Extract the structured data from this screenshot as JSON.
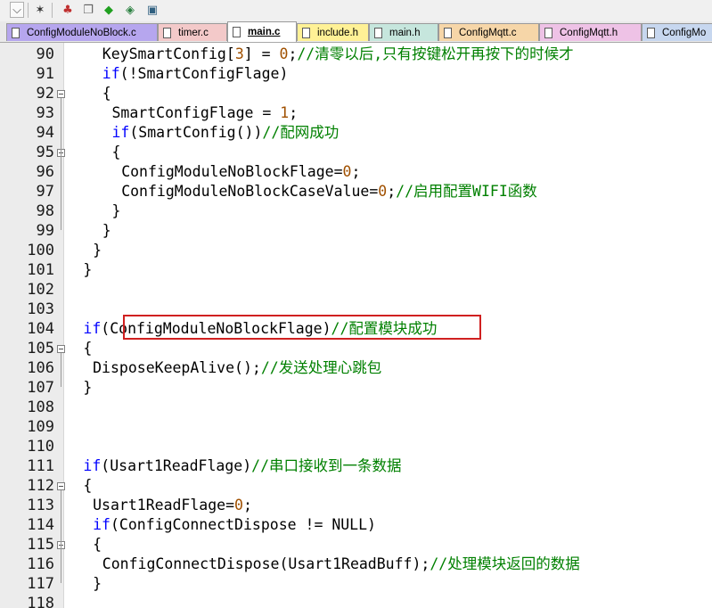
{
  "toolbar": {
    "buttons": [
      {
        "name": "dropdown-arrow-icon",
        "glyph": "⌵"
      },
      {
        "name": "wand-icon",
        "glyph": "✶"
      },
      {
        "name": "tree-icon",
        "glyph": "♣"
      },
      {
        "name": "window-stack-icon",
        "glyph": "❐"
      },
      {
        "name": "green-diamond-icon",
        "glyph": "◆"
      },
      {
        "name": "arrow-diamond-icon",
        "glyph": "◈"
      },
      {
        "name": "image-icon",
        "glyph": "▣"
      }
    ]
  },
  "tabs": [
    {
      "label": "ConfigModuleNoBlock.c",
      "color": "#b6a6ee",
      "active": false
    },
    {
      "label": "timer.c",
      "color": "#f3c9c9",
      "active": false
    },
    {
      "label": "main.c",
      "color": "#ffffff",
      "active": true
    },
    {
      "label": "include.h",
      "color": "#fff196",
      "active": false
    },
    {
      "label": "main.h",
      "color": "#c6e6dd",
      "active": false
    },
    {
      "label": "ConfigMqtt.c",
      "color": "#f6d6a8",
      "active": false
    },
    {
      "label": "ConfigMqtt.h",
      "color": "#eec2e6",
      "active": false
    },
    {
      "label": "ConfigMo",
      "color": "#c7d7ef",
      "active": false
    }
  ],
  "editor": {
    "lines": [
      {
        "num": "90",
        "indent": 4,
        "fold": "",
        "tokens": [
          [
            "p",
            "KeySmartConfig["
          ],
          [
            "n",
            "3"
          ],
          [
            "p",
            "] = "
          ],
          [
            "n",
            "0"
          ],
          [
            "p",
            ";"
          ],
          [
            "c",
            "//清零以后,只有按键松开再按下的时候才"
          ]
        ]
      },
      {
        "num": "91",
        "indent": 4,
        "fold": "",
        "tokens": [
          [
            "k",
            "if"
          ],
          [
            "p",
            "(!SmartConfigFlage)"
          ]
        ]
      },
      {
        "num": "92",
        "indent": 4,
        "fold": "box",
        "tokens": [
          [
            "p",
            "{"
          ]
        ]
      },
      {
        "num": "93",
        "indent": 5,
        "fold": "",
        "tokens": [
          [
            "p",
            "SmartConfigFlage = "
          ],
          [
            "n",
            "1"
          ],
          [
            "p",
            ";"
          ]
        ]
      },
      {
        "num": "94",
        "indent": 5,
        "fold": "",
        "tokens": [
          [
            "k",
            "if"
          ],
          [
            "p",
            "(SmartConfig())"
          ],
          [
            "c",
            "//配网成功"
          ]
        ]
      },
      {
        "num": "95",
        "indent": 5,
        "fold": "box",
        "tokens": [
          [
            "p",
            "{"
          ]
        ]
      },
      {
        "num": "96",
        "indent": 6,
        "fold": "",
        "tokens": [
          [
            "p",
            "ConfigModuleNoBlockFlage="
          ],
          [
            "n",
            "0"
          ],
          [
            "p",
            ";"
          ]
        ]
      },
      {
        "num": "97",
        "indent": 6,
        "fold": "",
        "tokens": [
          [
            "p",
            "ConfigModuleNoBlockCaseValue="
          ],
          [
            "n",
            "0"
          ],
          [
            "p",
            ";"
          ],
          [
            "c",
            "//启用配置WIFI函数"
          ]
        ]
      },
      {
        "num": "98",
        "indent": 5,
        "fold": "",
        "tokens": [
          [
            "p",
            "}"
          ]
        ]
      },
      {
        "num": "99",
        "indent": 4,
        "fold": "",
        "tokens": [
          [
            "p",
            "}"
          ]
        ]
      },
      {
        "num": "100",
        "indent": 3,
        "fold": "",
        "tokens": [
          [
            "p",
            "}"
          ]
        ]
      },
      {
        "num": "101",
        "indent": 2,
        "fold": "",
        "tokens": [
          [
            "p",
            "}"
          ]
        ]
      },
      {
        "num": "102",
        "indent": 0,
        "fold": "",
        "tokens": []
      },
      {
        "num": "103",
        "indent": 0,
        "fold": "",
        "tokens": []
      },
      {
        "num": "104",
        "indent": 2,
        "fold": "",
        "tokens": [
          [
            "k",
            "if"
          ],
          [
            "p",
            "(ConfigModuleNoBlockFlage)"
          ],
          [
            "c",
            "//配置模块成功"
          ]
        ]
      },
      {
        "num": "105",
        "indent": 2,
        "fold": "box",
        "tokens": [
          [
            "p",
            "{"
          ]
        ]
      },
      {
        "num": "106",
        "indent": 3,
        "fold": "",
        "tokens": [
          [
            "p",
            "DisposeKeepAlive();"
          ],
          [
            "c",
            "//发送处理心跳包"
          ]
        ]
      },
      {
        "num": "107",
        "indent": 2,
        "fold": "",
        "tokens": [
          [
            "p",
            "}"
          ]
        ]
      },
      {
        "num": "108",
        "indent": 0,
        "fold": "",
        "tokens": []
      },
      {
        "num": "109",
        "indent": 0,
        "fold": "",
        "tokens": []
      },
      {
        "num": "110",
        "indent": 0,
        "fold": "",
        "tokens": []
      },
      {
        "num": "111",
        "indent": 2,
        "fold": "",
        "tokens": [
          [
            "k",
            "if"
          ],
          [
            "p",
            "(Usart1ReadFlage)"
          ],
          [
            "c",
            "//串口接收到一条数据"
          ]
        ]
      },
      {
        "num": "112",
        "indent": 2,
        "fold": "box",
        "tokens": [
          [
            "p",
            "{"
          ]
        ]
      },
      {
        "num": "113",
        "indent": 3,
        "fold": "",
        "tokens": [
          [
            "p",
            "Usart1ReadFlage="
          ],
          [
            "n",
            "0"
          ],
          [
            "p",
            ";"
          ]
        ]
      },
      {
        "num": "114",
        "indent": 3,
        "fold": "",
        "tokens": [
          [
            "k",
            "if"
          ],
          [
            "p",
            "(ConfigConnectDispose != NULL)"
          ]
        ]
      },
      {
        "num": "115",
        "indent": 3,
        "fold": "box",
        "tokens": [
          [
            "p",
            "{"
          ]
        ]
      },
      {
        "num": "116",
        "indent": 4,
        "fold": "",
        "tokens": [
          [
            "p",
            "ConfigConnectDispose(Usart1ReadBuff);"
          ],
          [
            "c",
            "//处理模块返回的数据"
          ]
        ]
      },
      {
        "num": "117",
        "indent": 3,
        "fold": "",
        "tokens": [
          [
            "p",
            "}"
          ]
        ]
      },
      {
        "num": "118",
        "indent": 0,
        "fold": "",
        "tokens": []
      }
    ]
  },
  "colors": {
    "keyword": "#0000ff",
    "number": "#a05000",
    "comment": "#008000",
    "highlight_border": "#d02020"
  }
}
